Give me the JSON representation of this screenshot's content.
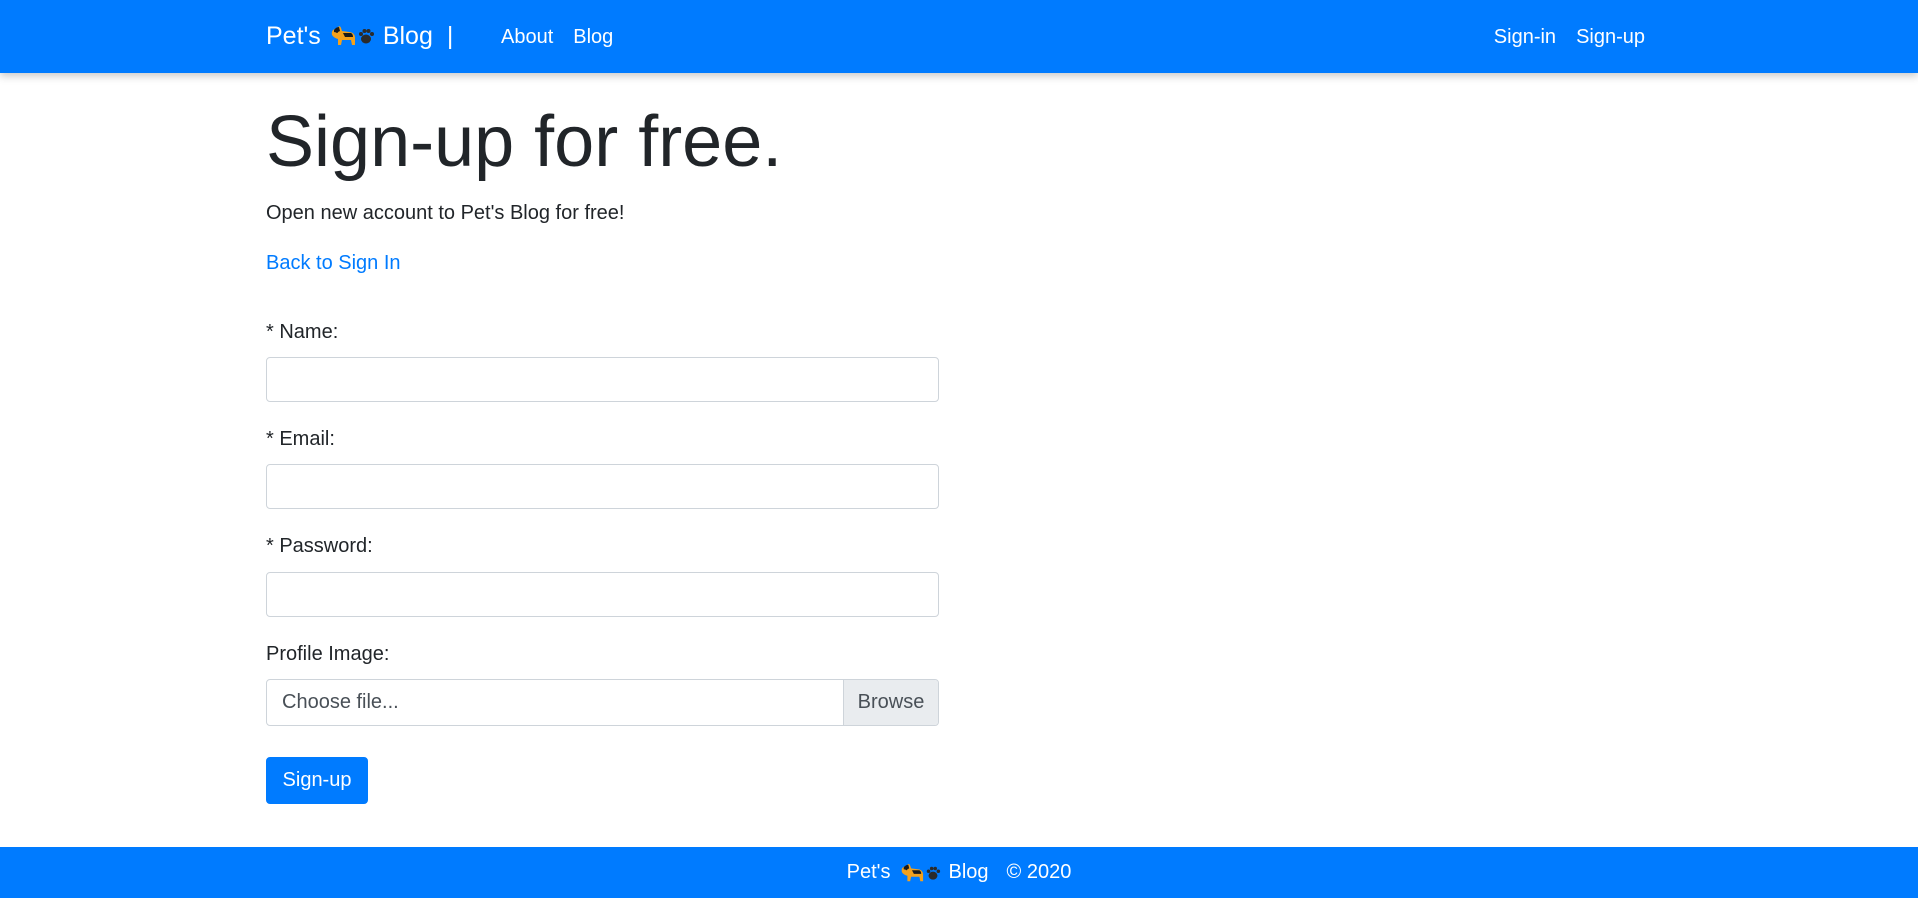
{
  "navbar": {
    "brand_prefix": "Pet's",
    "brand_suffix": "Blog",
    "brand_separator": "|",
    "brand_icons": [
      "dog-icon",
      "paw-icon"
    ],
    "left_links": [
      "About",
      "Blog"
    ],
    "right_links": [
      "Sign-in",
      "Sign-up"
    ]
  },
  "main": {
    "title": "Sign-up for free.",
    "lead": "Open new account to Pet's Blog for free!",
    "back_link": "Back to Sign In"
  },
  "form": {
    "name_label": "* Name:",
    "name_value": "",
    "email_label": "* Email:",
    "email_value": "",
    "password_label": "* Password:",
    "password_value": "",
    "image_label": "Profile Image:",
    "file_placeholder": "Choose file...",
    "file_button": "Browse",
    "submit_label": "Sign-up"
  },
  "footer": {
    "brand_prefix": "Pet's",
    "brand_suffix": "Blog",
    "copyright": "© 2020"
  },
  "colors": {
    "primary": "#007bff",
    "text": "#212529",
    "border": "#ced4da",
    "file_button_bg": "#e9ecef"
  }
}
